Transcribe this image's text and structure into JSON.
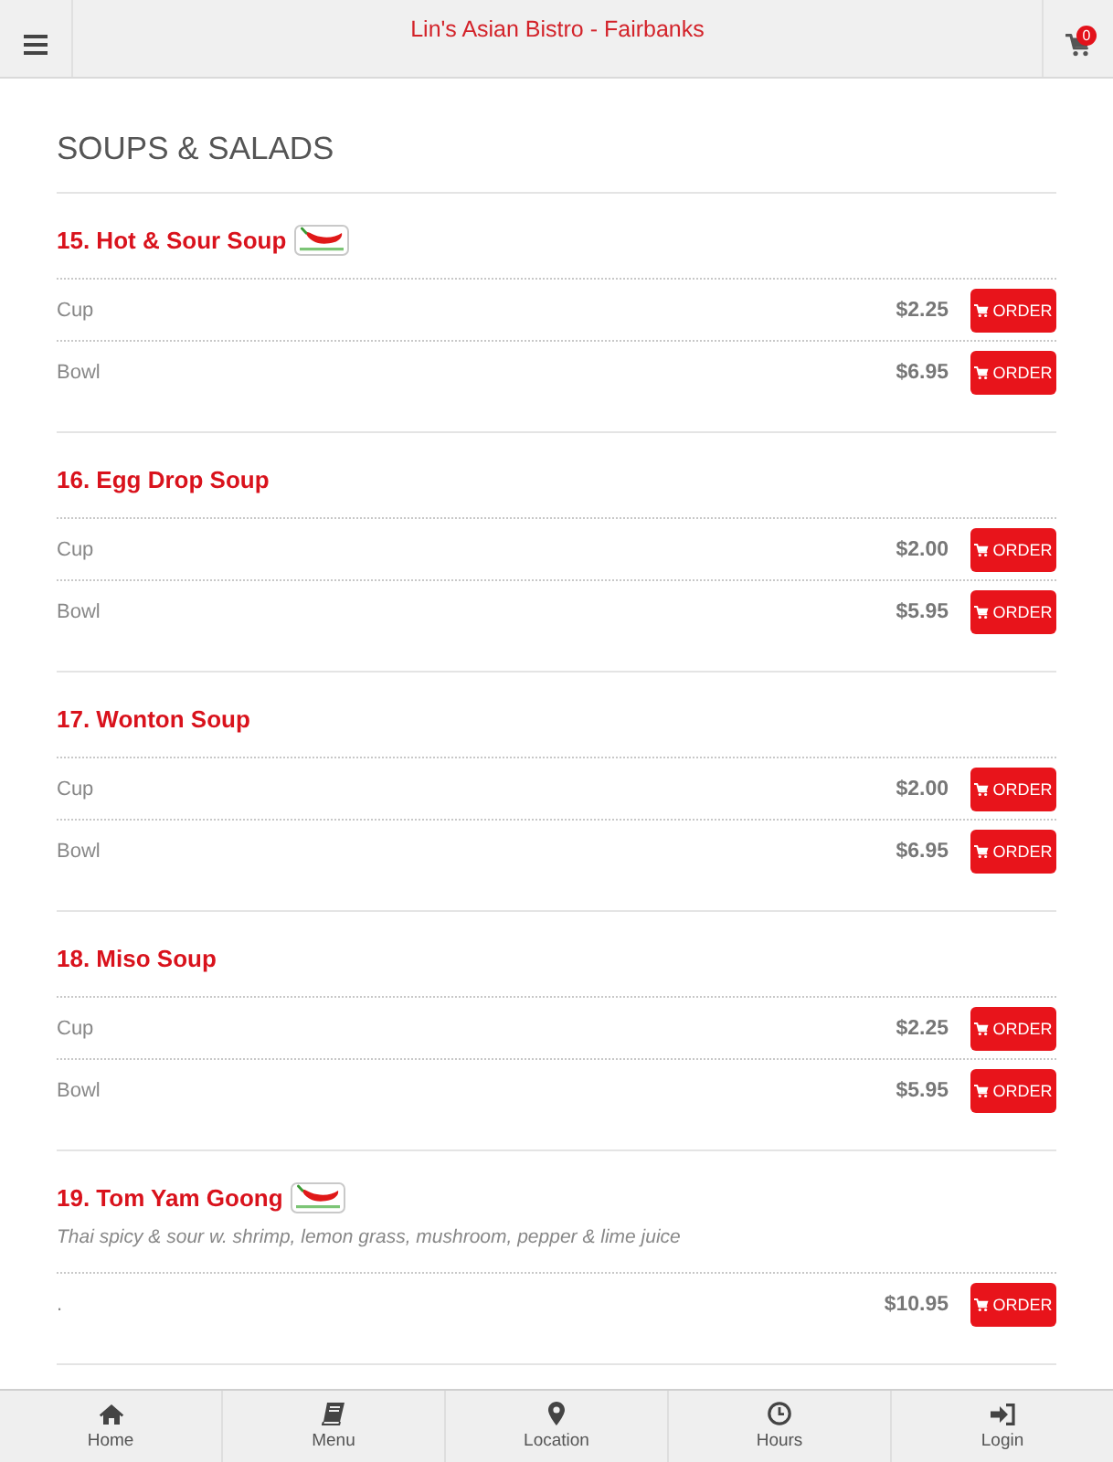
{
  "header": {
    "title": "Lin's Asian Bistro - Fairbanks",
    "cart_count": "0"
  },
  "category": {
    "title": "SOUPS & SALADS",
    "items": [
      {
        "name": "15. Hot & Sour Soup",
        "spicy": true,
        "options": [
          {
            "label": "Cup",
            "price": "$2.25",
            "button": "ORDER"
          },
          {
            "label": "Bowl",
            "price": "$6.95",
            "button": "ORDER"
          }
        ]
      },
      {
        "name": "16. Egg Drop Soup",
        "spicy": false,
        "options": [
          {
            "label": "Cup",
            "price": "$2.00",
            "button": "ORDER"
          },
          {
            "label": "Bowl",
            "price": "$5.95",
            "button": "ORDER"
          }
        ]
      },
      {
        "name": "17. Wonton Soup",
        "spicy": false,
        "options": [
          {
            "label": "Cup",
            "price": "$2.00",
            "button": "ORDER"
          },
          {
            "label": "Bowl",
            "price": "$6.95",
            "button": "ORDER"
          }
        ]
      },
      {
        "name": "18. Miso Soup",
        "spicy": false,
        "options": [
          {
            "label": "Cup",
            "price": "$2.25",
            "button": "ORDER"
          },
          {
            "label": "Bowl",
            "price": "$5.95",
            "button": "ORDER"
          }
        ]
      },
      {
        "name": "19. Tom Yam Goong",
        "spicy": true,
        "description": "Thai spicy & sour w. shrimp, lemon grass, mushroom, pepper & lime juice",
        "options": [
          {
            "label": ".",
            "price": "$10.95",
            "button": "ORDER"
          }
        ]
      }
    ]
  },
  "bottom_nav": [
    {
      "kind": "home",
      "label": "Home"
    },
    {
      "kind": "menu",
      "label": "Menu"
    },
    {
      "kind": "location",
      "label": "Location"
    },
    {
      "kind": "hours",
      "label": "Hours"
    },
    {
      "kind": "login",
      "label": "Login"
    }
  ]
}
